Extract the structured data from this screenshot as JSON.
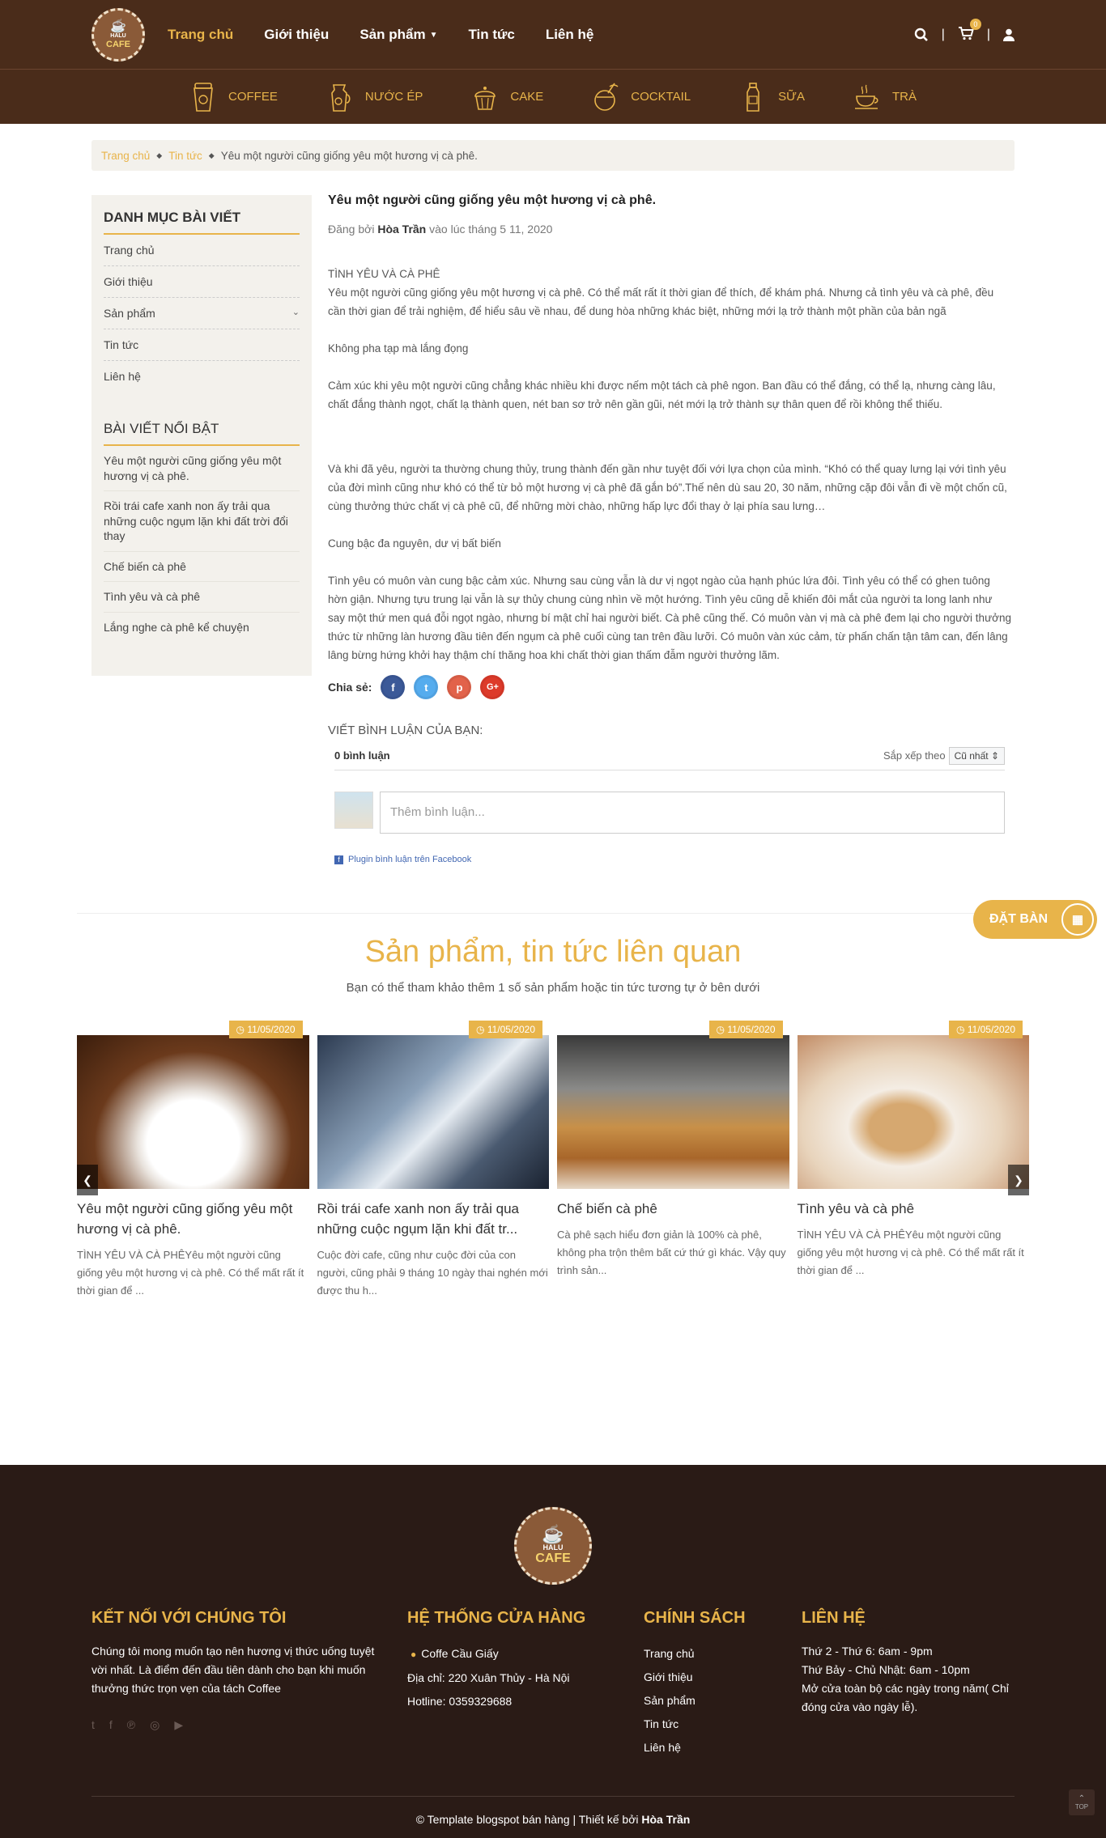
{
  "logo": {
    "t1": "HALU",
    "t2": "CAFE"
  },
  "nav": [
    {
      "label": "Trang chủ"
    },
    {
      "label": "Giới thiệu"
    },
    {
      "label": "Sản phẩm"
    },
    {
      "label": "Tin tức"
    },
    {
      "label": "Liên hệ"
    }
  ],
  "cart_count": "0",
  "categories": [
    {
      "label": "COFFEE"
    },
    {
      "label": "NƯỚC ÉP"
    },
    {
      "label": "CAKE"
    },
    {
      "label": "COCKTAIL"
    },
    {
      "label": "SỮA"
    },
    {
      "label": "TRÀ"
    }
  ],
  "breadcrumb": {
    "home": "Trang chủ",
    "news": "Tin tức",
    "current": "Yêu một người cũng giống yêu một hương vị cà phê."
  },
  "sidebar": {
    "cat_title": "DANH MỤC BÀI VIẾT",
    "cat_items": [
      {
        "label": "Trang chủ"
      },
      {
        "label": "Giới thiệu"
      },
      {
        "label": "Sản phẩm"
      },
      {
        "label": "Tin tức"
      },
      {
        "label": "Liên hệ"
      }
    ],
    "feat_title": "BÀI VIẾT NỔI BẬT",
    "feat_items": [
      {
        "label": "Yêu một người cũng giống yêu một hương vị cà phê."
      },
      {
        "label": "Rồi trái cafe xanh non ấy trải qua những cuộc ngụm lặn khi đất trời đổi thay"
      },
      {
        "label": "Chế biến cà phê"
      },
      {
        "label": "Tình yêu và cà phê"
      },
      {
        "label": "Lắng nghe cà phê kể chuyện"
      }
    ]
  },
  "article": {
    "title": "Yêu một người cũng giống yêu một hương vị cà phê.",
    "meta_prefix": "Đăng bởi",
    "author": "Hòa Trần",
    "meta_suffix": "vào lúc tháng 5 11, 2020",
    "p1_head": "TÌNH YÊU VÀ CÀ PHÊ",
    "p1": "Yêu một người cũng giống yêu một hương vị cà phê. Có thể mất rất ít thời gian để thích, để khám phá. Nhưng cả tình yêu và cà phê, đều cần thời gian để trải nghiệm, để hiểu sâu về nhau, để dung hòa những khác biệt, những mới lạ trở thành một phần của bản ngã",
    "p2": "Không pha tạp mà lắng đọng",
    "p3": "Cảm xúc khi yêu một người cũng chẳng khác nhiều khi được nếm một tách cà phê ngon. Ban đầu có thể đắng, có thể lạ, nhưng càng lâu, chất đắng thành ngọt, chất lạ thành quen, nét ban sơ trở nên gần gũi, nét mới lạ trở thành sự thân quen để rồi không thể thiếu.",
    "p4": "Và khi đã yêu, người ta thường chung thủy, trung thành đến gần như tuyệt đối với lựa chọn của mình. “Khó có thể quay lưng lại với tình yêu của đời mình cũng như khó có thể từ bỏ một hương vị cà phê đã gắn bó”.Thế nên dù sau 20, 30 năm, những cặp đôi vẫn đi về một chốn cũ, cùng thưởng thức chất vị cà phê cũ, để những mời chào, những hấp lực đổi thay ở lại phía sau lưng…",
    "p5": "Cung bậc đa nguyên, dư vị bất biến",
    "p6": "Tình yêu có muôn vàn cung bậc cảm xúc. Nhưng sau cùng vẫn là dư vị ngọt ngào của hạnh phúc lứa đôi. Tình yêu có thể có ghen tuông hờn giận. Nhưng tựu trung lại vẫn là sự thủy chung cùng nhìn về một hướng. Tình yêu cũng dễ khiến đôi mắt của người ta long lanh như say một thứ men quá đỗi ngọt ngào, nhưng bí mật chỉ hai người biết. Cà phê cũng thế. Có muôn vàn vị mà cà phê đem lại cho người thưởng thức từ những làn hương đầu tiên đến ngụm cà phê cuối cùng tan trên đầu lưỡi. Có muôn vàn xúc cảm, từ phấn chấn tận tâm can, đến lâng lâng bừng hứng khởi hay thậm chí thăng hoa khi chất thời gian thấm đẫm người thưởng lãm.",
    "share": "Chia sẻ:"
  },
  "comments": {
    "heading": "VIẾT BÌNH LUẬN CỦA BẠN:",
    "count": "0 bình luận",
    "sort_label": "Sắp xếp theo",
    "sort_value": "Cũ nhất",
    "placeholder": "Thêm bình luận...",
    "plugin": "Plugin bình luận trên Facebook"
  },
  "booking": "ĐẶT BÀN",
  "related": {
    "title": "Sản phẩm, tin tức liên quan",
    "subtitle": "Bạn có thể tham khảo thêm 1 số sản phẩm hoặc tin tức tương tự ở bên dưới",
    "cards": [
      {
        "date": "11/05/2020",
        "title": "Yêu một người cũng giống yêu một hương vị cà phê.",
        "desc": "TÌNH YÊU VÀ CÀ PHÊYêu một người cũng giống yêu một hương vị cà phê. Có thể mất rất ít thời gian để ..."
      },
      {
        "date": "11/05/2020",
        "title": "Rồi trái cafe xanh non ấy trải qua những cuộc ngụm lặn khi đất tr...",
        "desc": "Cuộc đời cafe, cũng như cuộc đời của con người, cũng phải 9 tháng 10 ngày thai nghén mới được thu h..."
      },
      {
        "date": "11/05/2020",
        "title": "Chế biến cà phê",
        "desc": "Cà phê sạch hiểu đơn giản là 100% cà phê, không pha trộn thêm bất cứ thứ gì khác. Vậy quy trình sản..."
      },
      {
        "date": "11/05/2020",
        "title": "Tình yêu và cà phê",
        "desc": "TÌNH YÊU VÀ CÀ PHÊYêu một người cũng giống yêu một hương vị cà phê. Có thể mất rất ít thời gian để ..."
      }
    ]
  },
  "footer": {
    "logo": {
      "t1": "HALU",
      "t2": "CAFE"
    },
    "c1_title": "KẾT NỐI VỚI CHÚNG TÔI",
    "c1_body": "Chúng tôi mong muốn tạo nên hương vị thức uống tuyệt vời nhất. Là điểm đến đầu tiên dành cho bạn khi muốn thưởng thức trọn vẹn của tách Coffee",
    "c2_title": "HỆ THỐNG CỬA HÀNG",
    "c2_store": "Coffe Cầu Giấy",
    "c2_addr": "Địa chỉ: 220 Xuân Thủy - Hà Nội",
    "c2_phone": "Hotline: 0359329688",
    "c3_title": "CHÍNH SÁCH",
    "c3_items": [
      {
        "label": "Trang chủ"
      },
      {
        "label": "Giới thiệu"
      },
      {
        "label": "Sản phẩm"
      },
      {
        "label": "Tin tức"
      },
      {
        "label": "Liên hệ"
      }
    ],
    "c4_title": "LIÊN HỆ",
    "c4_l1": "Thứ 2 - Thứ 6: 6am - 9pm",
    "c4_l2": "Thứ Bảy - Chủ Nhật: 6am - 10pm",
    "c4_l3": "Mở cửa toàn bộ các ngày trong năm( Chỉ đóng cửa vào ngày lễ).",
    "copy_prefix": "© Template blogspot bán hàng | Thiết kế bởi",
    "copy_author": "Hòa Trần",
    "top": "TOP"
  }
}
